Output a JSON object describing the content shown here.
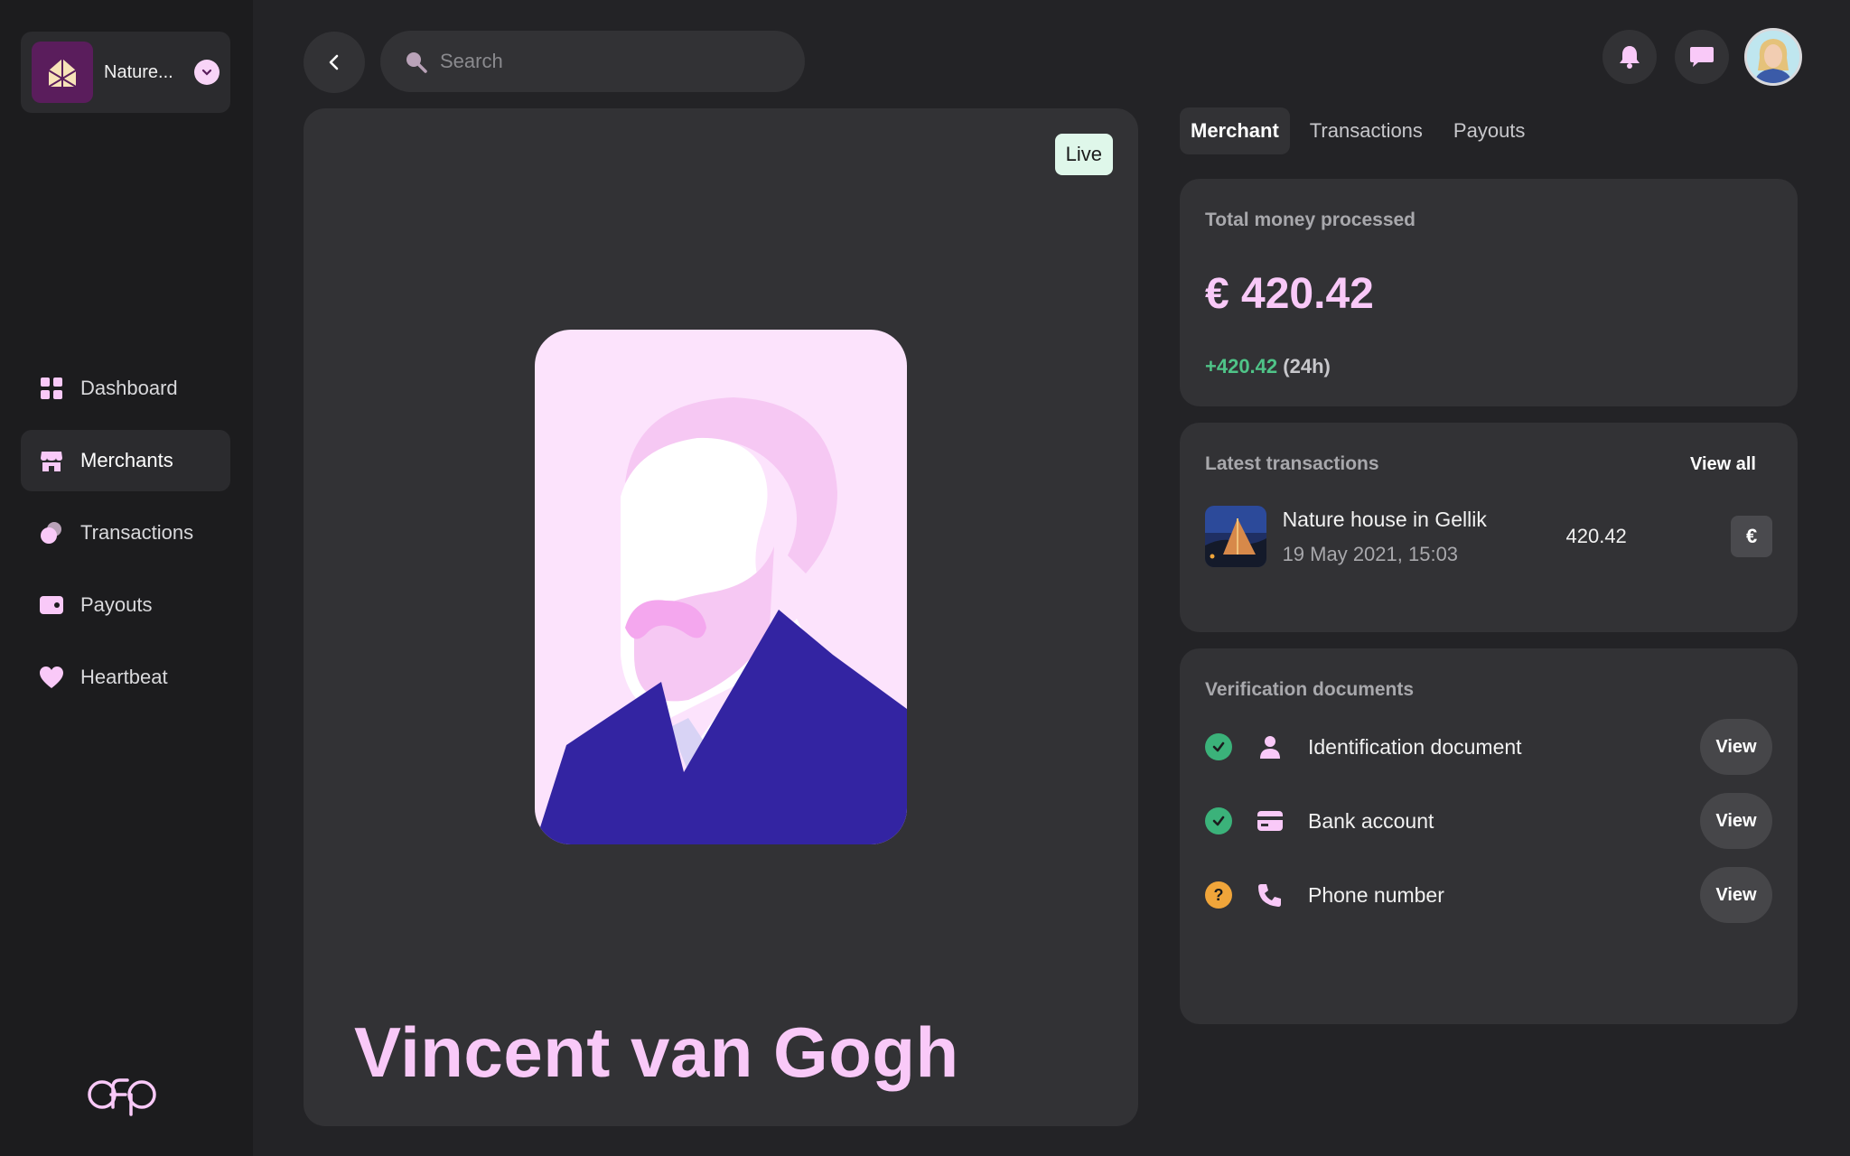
{
  "sidebar": {
    "workspace_name": "Nature...",
    "items": [
      {
        "label": "Dashboard",
        "icon": "grid-icon"
      },
      {
        "label": "Merchants",
        "icon": "store-icon",
        "active": true
      },
      {
        "label": "Transactions",
        "icon": "coins-icon"
      },
      {
        "label": "Payouts",
        "icon": "wallet-icon"
      },
      {
        "label": "Heartbeat",
        "icon": "heart-icon"
      }
    ]
  },
  "search": {
    "placeholder": "Search"
  },
  "merchant": {
    "status": "Live",
    "name": "Vincent van Gogh"
  },
  "tabs": [
    "Merchant",
    "Transactions",
    "Payouts"
  ],
  "summary": {
    "title": "Total money processed",
    "amount": "€ 420.42",
    "delta": "+420.42",
    "period": "(24h)"
  },
  "latest": {
    "title": "Latest transactions",
    "view_all": "View all",
    "item": {
      "name": "Nature house in Gellik",
      "date": "19 May 2021, 15:03",
      "amount": "420.42",
      "currency": "€"
    }
  },
  "verification": {
    "title": "Verification documents",
    "docs": [
      {
        "label": "Identification document",
        "status": "verified",
        "button": "View"
      },
      {
        "label": "Bank account",
        "status": "verified",
        "button": "View"
      },
      {
        "label": "Phone number",
        "status": "pending",
        "status_mark": "?",
        "button": "View"
      }
    ]
  },
  "colors": {
    "accent": "#f9c9f8",
    "success": "#3bb27a",
    "warning": "#f0a53a",
    "background": "#232326",
    "surface": "#323235"
  }
}
